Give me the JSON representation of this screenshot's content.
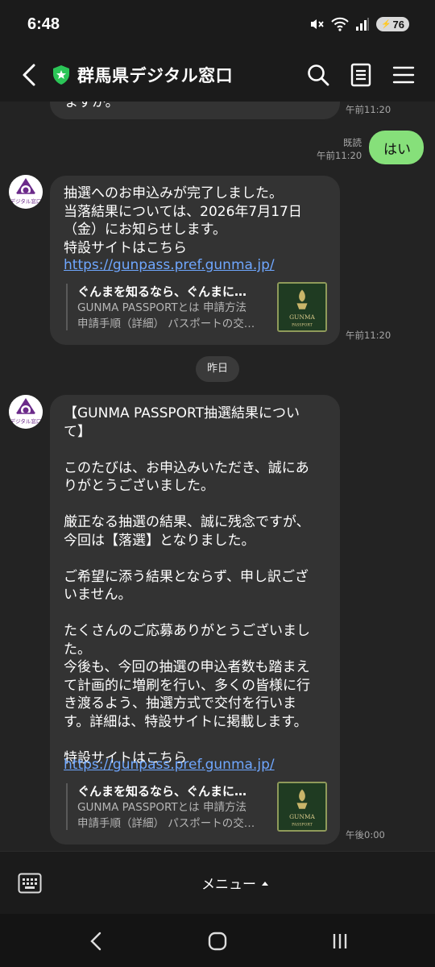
{
  "status": {
    "time": "6:48",
    "battery": "76"
  },
  "header": {
    "title": "群馬県デジタル窓口"
  },
  "messages": {
    "prev_fragment": "ますか。",
    "prev_time": "午前11:20",
    "my_text": "はい",
    "my_read": "既読",
    "my_time": "午前11:20",
    "msg1": {
      "text": "抽選へのお申込みが完了しました。\n当落結果については、2026年7月17日\n（金）にお知らせします。\n特設サイトはこちら",
      "link": "https://gunpass.pref.gunma.jp/",
      "preview_title": "ぐんまを知るなら、ぐんまに…",
      "preview_line1": "GUNMA PASSPORTとは 申請方法",
      "preview_line2": "申請手順（詳細） パスポートの交…",
      "time": "午前11:20"
    },
    "date_separator": "昨日",
    "msg2": {
      "text": "【GUNMA PASSPORT抽選結果につい\nて】\n\nこのたびは、お申込みいただき、誠にあ\nりがとうございました。\n\n厳正なる抽選の結果、誠に残念ですが、\n今回は【落選】となりました。\n\nご希望に添う結果とならず、申し訳ござ\nいません。\n\nたくさんのご応募ありがとうございまし\nた。\n今後も、今回の抽選の申込者数も踏まえ\nて計画的に増刷を行い、多くの皆様に行\nき渡るよう、抽選方式で交付を行いま\nす。詳細は、特設サイトに掲載します。\n\n特設サイトはこちら",
      "link": "https://gunpass.pref.gunma.jp/",
      "preview_title": "ぐんまを知るなら、ぐんまに…",
      "preview_line1": "GUNMA PASSPORTとは 申請方法",
      "preview_line2": "申請手順（詳細） パスポートの交…",
      "time": "午後0:00"
    }
  },
  "avatar_label": "デジタル窓口",
  "thumb": {
    "line1": "GUNMA",
    "line2": "PASSPORT"
  },
  "footer": {
    "menu_label": "メニュー"
  },
  "colors": {
    "accent_green": "#86e07a",
    "link_blue": "#6fa7ff",
    "bubble": "#333333"
  }
}
